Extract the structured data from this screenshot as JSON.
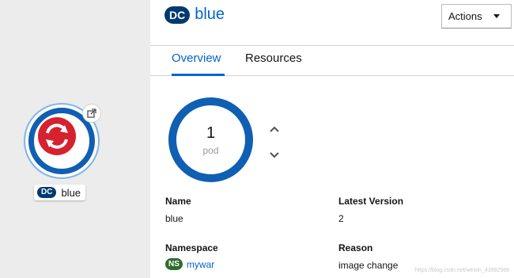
{
  "canvas": {
    "node": {
      "kind_badge": "DC",
      "name": "blue"
    }
  },
  "panel": {
    "header": {
      "kind_badge": "DC",
      "title": "blue",
      "actions_label": "Actions"
    },
    "tabs": [
      {
        "label": "Overview",
        "active": true
      },
      {
        "label": "Resources",
        "active": false
      }
    ],
    "pods": {
      "count": "1",
      "unit": "pod"
    },
    "details": {
      "name_label": "Name",
      "name_value": "blue",
      "latest_version_label": "Latest Version",
      "latest_version_value": "2",
      "namespace_label": "Namespace",
      "namespace_badge": "NS",
      "namespace_value": "mywar",
      "reason_label": "Reason",
      "reason_value": "image change"
    },
    "watermark": "https://blog.csdn.net/weixin_43992566"
  },
  "colors": {
    "brand_blue": "#0066cc",
    "ring_blue": "#0f5fb3",
    "dc_badge": "#003a70",
    "ns_badge": "#2f6b2f",
    "openshift_red": "#d6212e"
  }
}
